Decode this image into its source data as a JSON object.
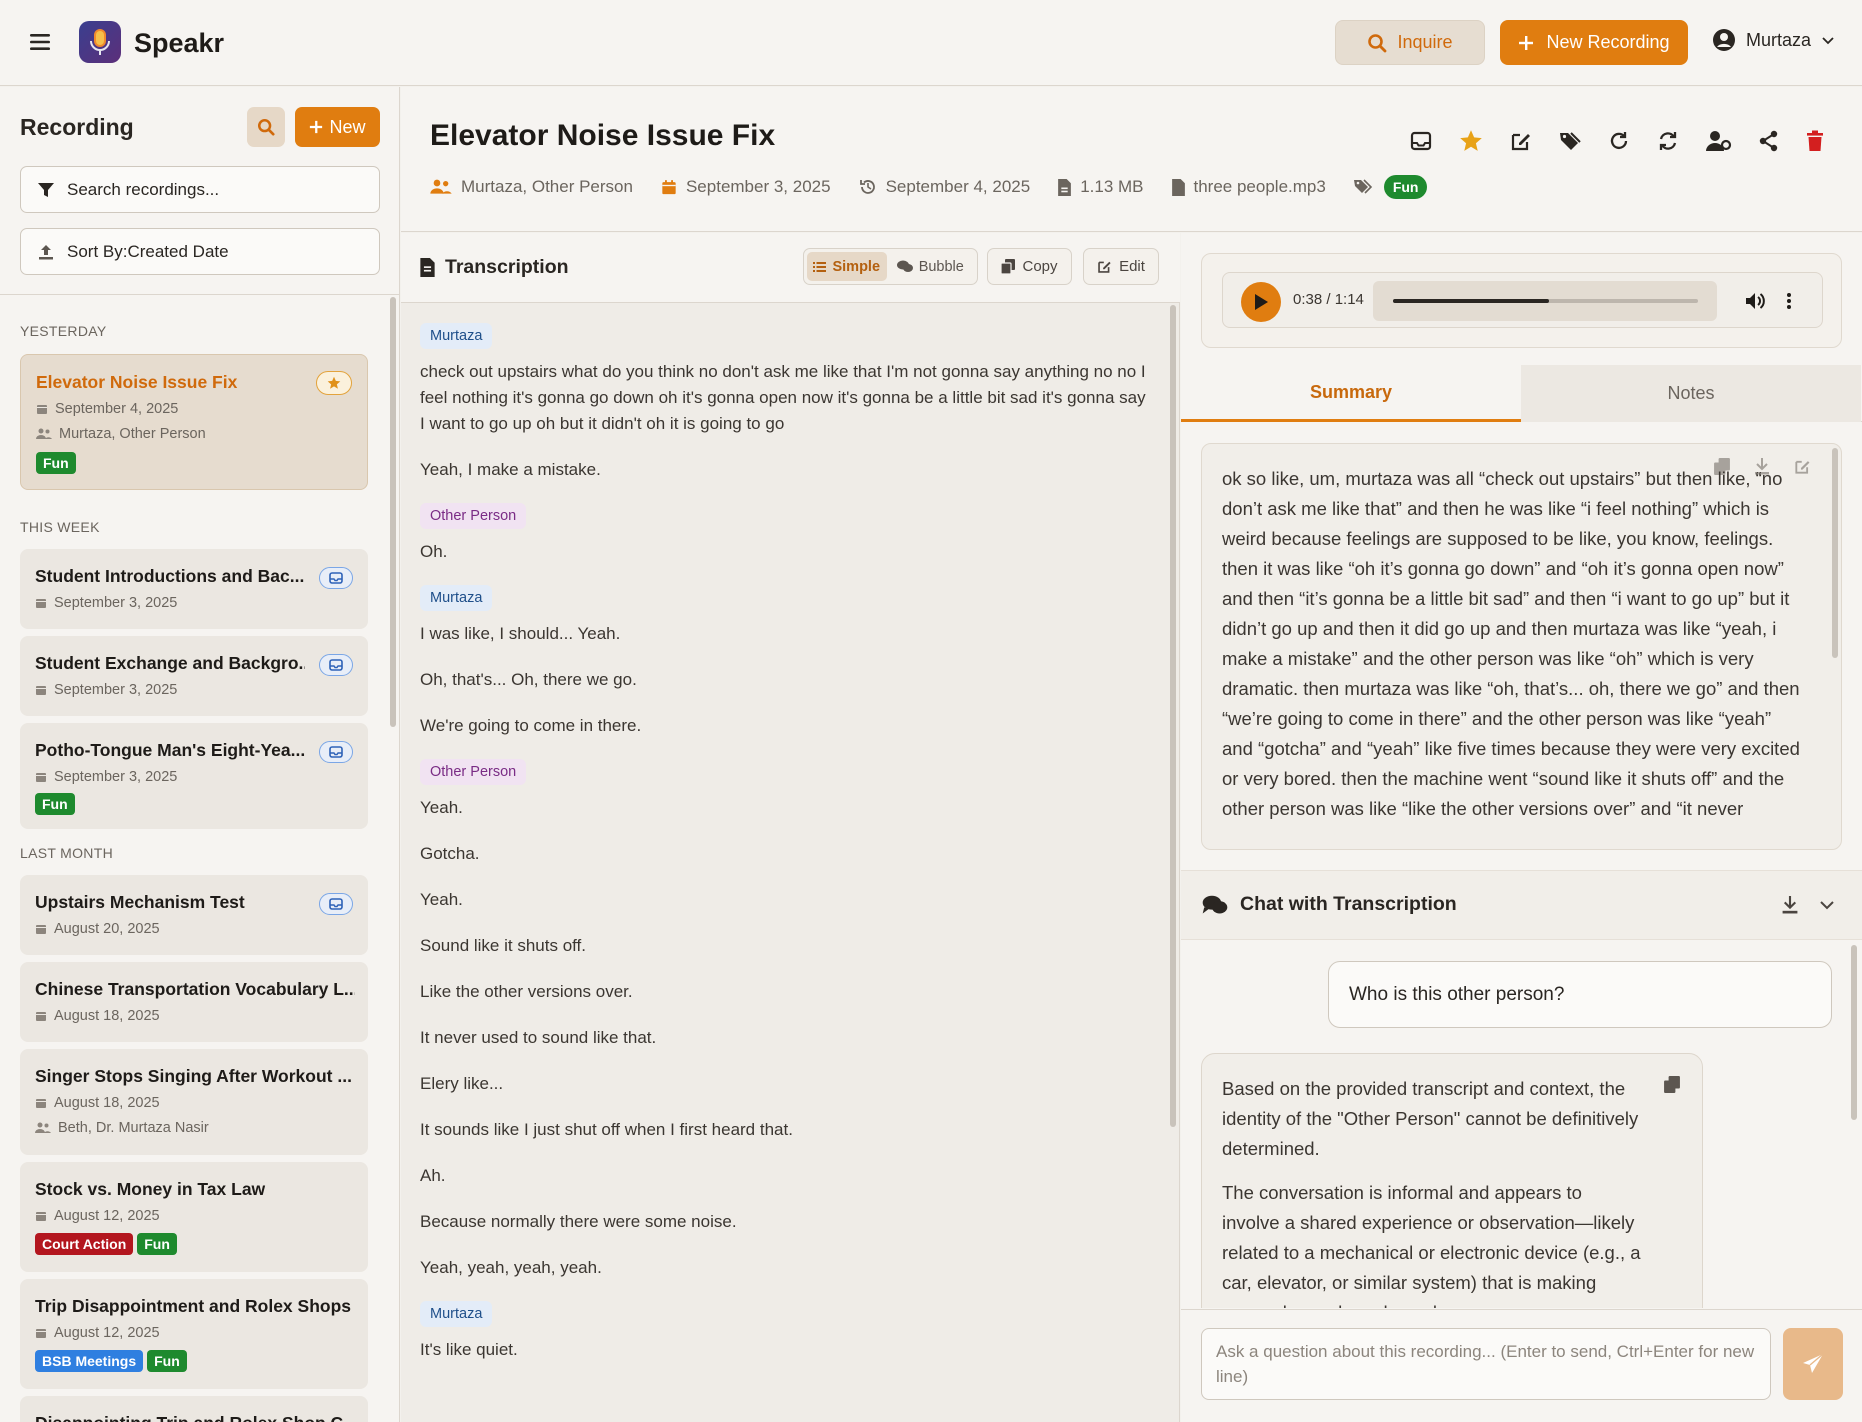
{
  "app": {
    "name": "Speakr"
  },
  "topbar": {
    "inquire_label": "Inquire",
    "new_recording_label": "New Recording",
    "user_name": "Murtaza"
  },
  "sidebar": {
    "title": "Recording",
    "new_label": "New",
    "search_placeholder": "Search recordings...",
    "sort_label": "Sort By:Created Date",
    "groups": [
      {
        "label": "YESTERDAY",
        "items": [
          {
            "title": "Elevator Noise Issue Fix",
            "date": "September 4, 2025",
            "people": "Murtaza, Other Person",
            "tags": [
              "Fun"
            ],
            "badge": "star-icon"
          }
        ]
      },
      {
        "label": "THIS WEEK",
        "items": [
          {
            "title": "Student Introductions and Bac...",
            "date": "September 3, 2025",
            "badge": "inbox-icon"
          },
          {
            "title": "Student Exchange and Backgro...",
            "date": "September 3, 2025",
            "badge": "inbox-icon"
          },
          {
            "title": "Potho-Tongue Man's Eight-Yea...",
            "date": "September 3, 2025",
            "tags": [
              "Fun"
            ],
            "badge": "inbox-icon"
          }
        ]
      },
      {
        "label": "LAST MONTH",
        "items": [
          {
            "title": "Upstairs Mechanism Test",
            "date": "August 20, 2025",
            "badge": "inbox-icon"
          },
          {
            "title": "Chinese Transportation Vocabulary L...",
            "date": "August 18, 2025"
          },
          {
            "title": "Singer Stops Singing After Workout ...",
            "date": "August 18, 2025",
            "people": "Beth, Dr. Murtaza Nasir"
          },
          {
            "title": "Stock vs. Money in Tax Law",
            "date": "August 12, 2025",
            "tags": [
              "Court Action",
              "Fun"
            ]
          },
          {
            "title": "Trip Disappointment and Rolex Shops",
            "date": "August 12, 2025",
            "tags": [
              "BSB Meetings",
              "Fun"
            ]
          },
          {
            "title": "Disappointing Trip and Rolex Shop C...",
            "date": ""
          }
        ]
      }
    ]
  },
  "tag_colors": {
    "Fun": "#1e8a2e",
    "Court Action": "#b3161e",
    "BSB Meetings": "#2f7fe0"
  },
  "recording": {
    "title": "Elevator Noise Issue Fix",
    "participants": "Murtaza, Other Person",
    "created": "September 3, 2025",
    "updated": "September 4, 2025",
    "size": "1.13 MB",
    "filename": "three people.mp3",
    "tag": "Fun"
  },
  "transcription": {
    "title": "Transcription",
    "view_simple": "Simple",
    "view_bubble": "Bubble",
    "copy_label": "Copy",
    "edit_label": "Edit",
    "blocks": [
      {
        "speaker": "Murtaza",
        "lines": [
          "check out upstairs what do you think no don't ask me like that I'm not gonna say anything no no I feel nothing it's gonna go down oh it's gonna open now it's gonna be a little bit sad it's gonna say I want to go up oh but it didn't oh it is going to go",
          "Yeah, I make a mistake."
        ]
      },
      {
        "speaker": "Other Person",
        "lines": [
          "Oh."
        ]
      },
      {
        "speaker": "Murtaza",
        "lines": [
          "I was like, I should... Yeah.",
          "Oh, that's... Oh, there we go.",
          "We're going to come in there."
        ]
      },
      {
        "speaker": "Other Person",
        "lines": [
          "Yeah.",
          "Gotcha.",
          "Yeah.",
          "Sound like it shuts off.",
          "Like the other versions over.",
          "It never used to sound like that.",
          "Elery like...",
          "It sounds like I just shut off when I first heard that.",
          "Ah.",
          "Because normally there were some noise.",
          "Yeah, yeah, yeah, yeah."
        ]
      },
      {
        "speaker": "Murtaza",
        "lines": [
          "It's like quiet."
        ]
      }
    ]
  },
  "player": {
    "time": "0:38 / 1:14",
    "progress": 0.51
  },
  "tabs": {
    "summary": "Summary",
    "notes": "Notes"
  },
  "summary": {
    "text": "ok so like, um, murtaza was all “check out upstairs” but then like, “no don’t ask me like that” and then he was like “i feel nothing” which is weird because feelings are supposed to be like, you know, feelings. then it was like “oh it’s gonna go down” and “oh it’s gonna open now” and then “it’s gonna be a little bit sad” and then “i want to go up” but it didn’t go up and then it did go up and then murtaza was like “yeah, i make a mistake” and the other person was like “oh” which is very dramatic. then murtaza was like “oh, that’s... oh, there we go” and then “we’re going to come in there” and the other person was like “yeah” and “gotcha” and “yeah” like five times because they were very excited or very bored. then the machine went “sound like it shuts off” and the other person was like “like the other versions over” and “it never"
  },
  "chat": {
    "title": "Chat with Transcription",
    "user_message": "Who is this other person?",
    "ai_p1": "Based on the provided transcript and context, the identity of the \"Other Person\" cannot be definitively determined.",
    "ai_p2": "The conversation is informal and appears to involve a shared experience or observation—likely related to a mechanical or electronic device (e.g., a car, elevator, or similar system) that is making unusual sounds and may be",
    "input_placeholder": "Ask a question about this recording... (Enter to send, Ctrl+Enter for new line)"
  }
}
